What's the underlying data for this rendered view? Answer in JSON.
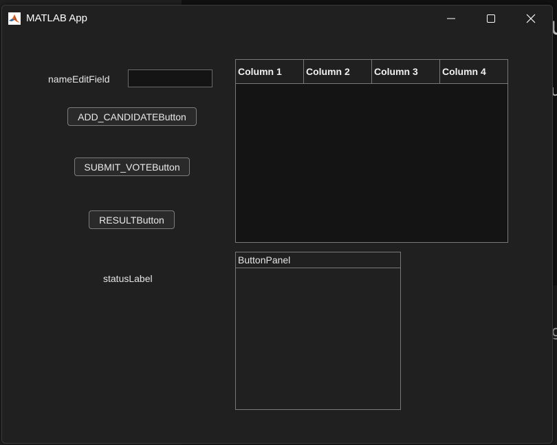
{
  "window": {
    "title": "MATLAB App"
  },
  "form": {
    "name_label": "nameEditField",
    "name_value": "",
    "add_button": "ADD_CANDIDATEButton",
    "submit_button": "SUBMIT_VOTEButton",
    "result_button": "RESULTButton",
    "status_label": "statusLabel"
  },
  "table": {
    "columns": [
      "Column 1",
      "Column 2",
      "Column 3",
      "Column 4"
    ],
    "rows": []
  },
  "panel": {
    "title": "ButtonPanel"
  },
  "icons": {
    "app": "matlab-logo-icon",
    "minimize": "minimize-icon",
    "maximize": "maximize-icon",
    "close": "close-icon"
  },
  "colors": {
    "window_bg": "#202020",
    "table_bg": "#141414",
    "border": "#7a7a7a",
    "text": "#e6e6e6"
  }
}
